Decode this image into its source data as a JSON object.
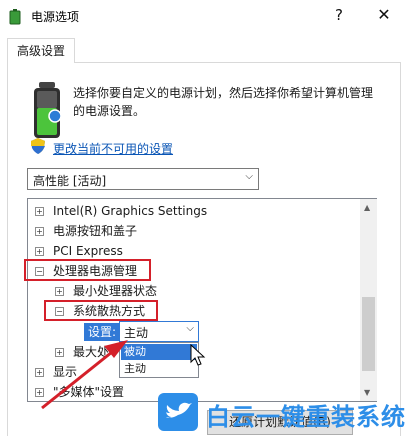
{
  "window": {
    "title": "电源选项",
    "help_label": "?",
    "close_label": "✕"
  },
  "tab": {
    "label": "高级设置"
  },
  "intro": {
    "text": "选择你要自定义的电源计划，然后选择你希望计算机管理的电源设置。"
  },
  "link": {
    "text": "更改当前不可用的设置"
  },
  "plan": {
    "value": "高性能 [活动]"
  },
  "tree": {
    "items": [
      {
        "label": "Intel(R) Graphics Settings",
        "expander": "+"
      },
      {
        "label": "电源按钮和盖子",
        "expander": "+"
      },
      {
        "label": "PCI Express",
        "expander": "+"
      },
      {
        "label": "处理器电源管理",
        "expander": "−"
      },
      {
        "label": "最小处理器状态",
        "expander": "+"
      },
      {
        "label": "系统散热方式",
        "expander": "−"
      },
      {
        "label": "最大处",
        "expander": "+"
      },
      {
        "label": "显示",
        "expander": "+"
      },
      {
        "label": "\"多媒体\"设置",
        "expander": "+"
      }
    ]
  },
  "setting": {
    "label": "设置:",
    "value": "主动",
    "options": [
      "被动",
      "主动"
    ]
  },
  "restore": {
    "label": "还原计划默认值(R)"
  },
  "watermark": {
    "text": "白云一键重装系统"
  },
  "colors": {
    "accent": "#3179d6",
    "highlight_border": "#d4202a",
    "link": "#0a55b5",
    "watermark": "#2d8ee8"
  }
}
